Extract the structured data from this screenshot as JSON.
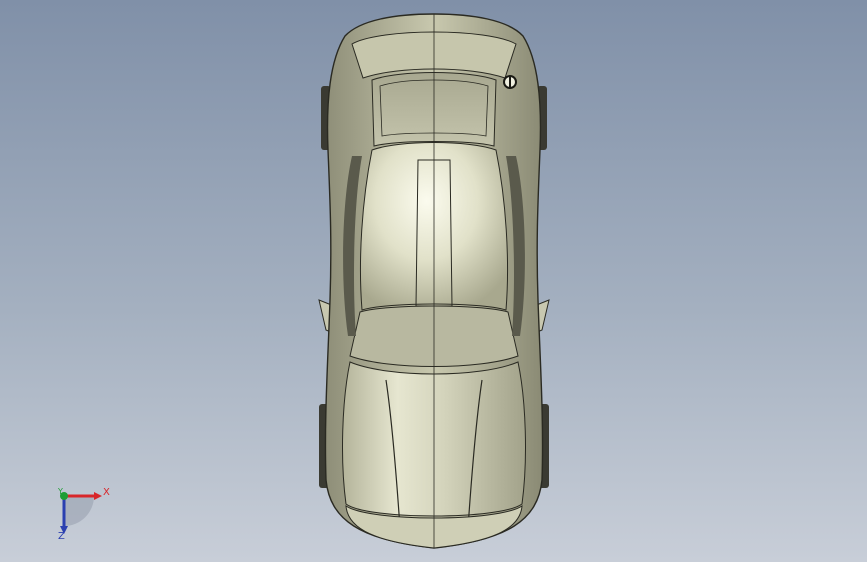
{
  "viewport": {
    "background_top": "#8090a8",
    "background_bottom": "#c8ced8",
    "model": "car-top-view",
    "body_color": "#d6d6bc",
    "edge_color": "#2a2a22"
  },
  "triad": {
    "x_label": "X",
    "y_label": "Y",
    "z_label": "Z",
    "x_color": "#d8262a",
    "y_color": "#1e9e34",
    "z_color": "#2a3fb0"
  }
}
